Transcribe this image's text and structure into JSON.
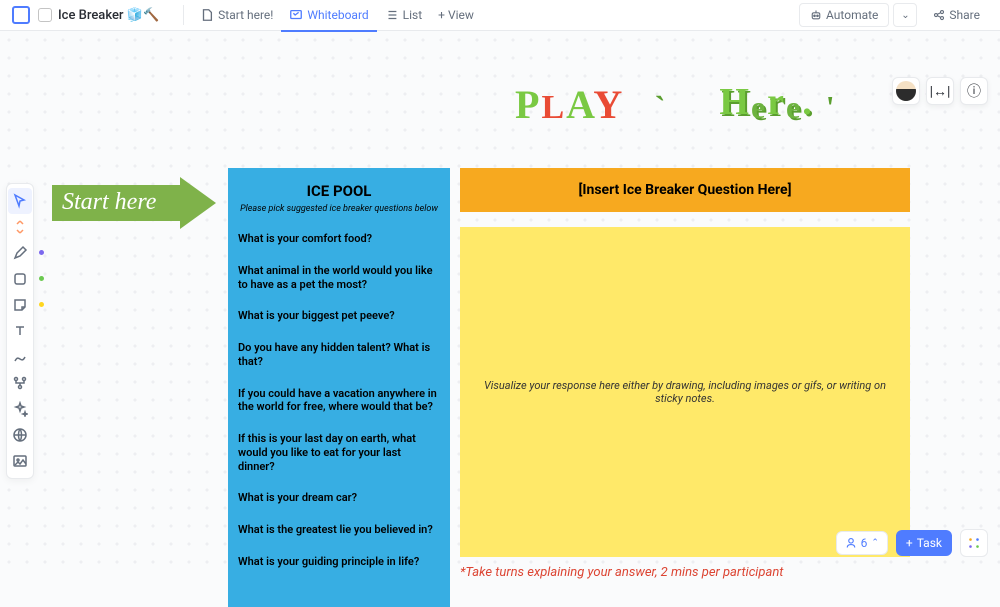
{
  "header": {
    "project_title": "Ice Breaker 🧊🔨",
    "tabs": {
      "start": "Start here!",
      "whiteboard": "Whiteboard",
      "list": "List",
      "addview": "+ View"
    },
    "automate": "Automate",
    "share": "Share"
  },
  "title_art": {
    "play": "PLAY",
    "here": "Here."
  },
  "arrow_label": "Start here",
  "ice_pool": {
    "title": "ICE POOL",
    "subtitle": "Please pick suggested ice breaker questions below",
    "questions": [
      "What is your comfort food?",
      "What animal in the world would you like to have as a pet the most?",
      "What is your biggest pet peeve?",
      "Do you have any hidden talent? What is that?",
      " If you could have a vacation anywhere in the world for free, where would that be?",
      "If this is your last day on earth, what would you like to eat for your last dinner?",
      "What is your dream car?",
      "What is the greatest lie you believed in?",
      "What is your guiding principle in life?"
    ]
  },
  "question_header": "[Insert Ice Breaker Question Here]",
  "response_prompt": "Visualize your response here either by drawing, including images or gifs, or writing on sticky notes.",
  "footnote": "*Take turns explaining your answer, 2 mins per participant",
  "bottom": {
    "count": "6",
    "task_label": "Task"
  }
}
